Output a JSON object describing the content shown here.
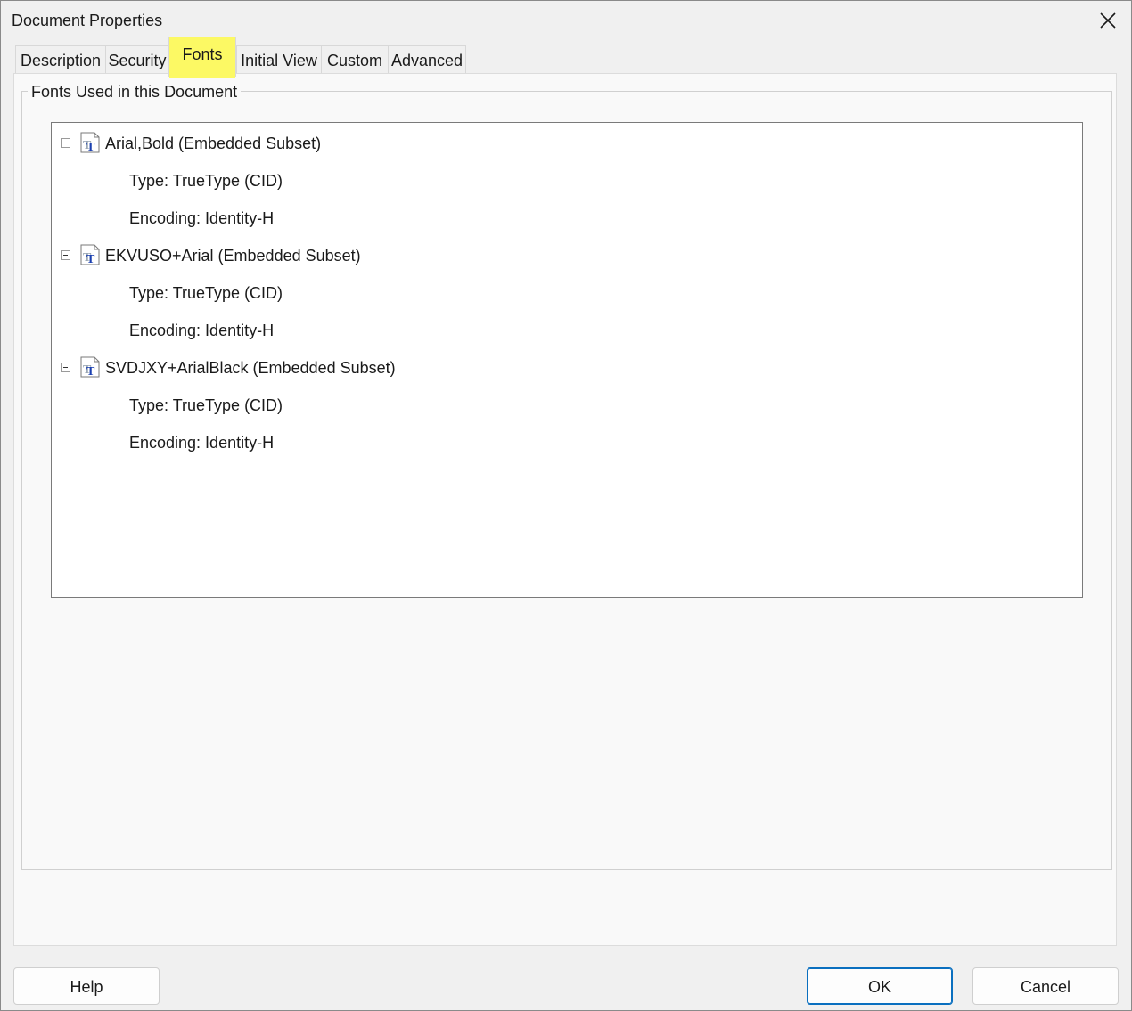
{
  "window": {
    "title": "Document Properties",
    "close_icon": "close-icon"
  },
  "tabs": [
    {
      "label": "Description"
    },
    {
      "label": "Security"
    },
    {
      "label": "Fonts",
      "active": true
    },
    {
      "label": "Initial View"
    },
    {
      "label": "Custom"
    },
    {
      "label": "Advanced"
    }
  ],
  "highlight_color": "#fdf94a",
  "fonts_group": {
    "legend": "Fonts Used in this Document",
    "fonts": [
      {
        "name": "Arial,Bold (Embedded Subset)",
        "type": "Type: TrueType (CID)",
        "encoding": "Encoding: Identity-H"
      },
      {
        "name": "EKVUSO+Arial (Embedded Subset)",
        "type": "Type: TrueType (CID)",
        "encoding": "Encoding: Identity-H"
      },
      {
        "name": "SVDJXY+ArialBlack (Embedded Subset)",
        "type": "Type: TrueType (CID)",
        "encoding": "Encoding: Identity-H"
      }
    ]
  },
  "buttons": {
    "help": "Help",
    "ok": "OK",
    "cancel": "Cancel"
  },
  "accent_color": "#0a6fbf"
}
